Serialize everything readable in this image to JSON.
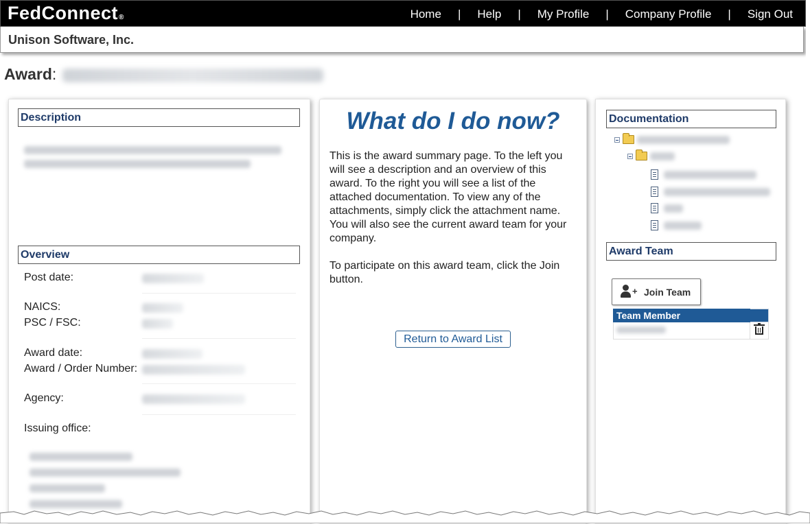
{
  "brand": {
    "logo_text": "FedConnect",
    "reg_mark": "®"
  },
  "nav": {
    "items": [
      {
        "label": "Home"
      },
      {
        "label": "Help"
      },
      {
        "label": "My Profile"
      },
      {
        "label": "Company Profile"
      },
      {
        "label": "Sign Out"
      }
    ],
    "separator": "|"
  },
  "company": {
    "name": "Unison Software, Inc."
  },
  "award": {
    "label": "Award",
    "colon": ":"
  },
  "description": {
    "heading": "Description"
  },
  "overview": {
    "heading": "Overview",
    "fields": {
      "post_date": "Post date:",
      "naics": "NAICS:",
      "psc_fsc": "PSC / FSC:",
      "award_date": "Award date:",
      "award_order_number": "Award / Order Number:",
      "agency": "Agency:",
      "issuing_office": "Issuing office:"
    }
  },
  "help": {
    "title": "What do I do now?",
    "paragraph1": "This is the award summary page. To the left you will see a description and an overview of this award. To the right you will see a list of the attached documentation. To view any of the attachments, simply click the attachment name. You will also see the current award team for your company.",
    "paragraph2": "To participate on this award team, click the Join button.",
    "return_button": "Return to Award List"
  },
  "documentation": {
    "heading": "Documentation"
  },
  "award_team": {
    "heading": "Award Team",
    "join_button": "Join Team",
    "table_header": "Team Member"
  },
  "colors": {
    "nav_bg": "#000000",
    "accent_blue": "#1f5a96",
    "heading_blue": "#1e3a68",
    "folder_yellow": "#f2cb52"
  }
}
